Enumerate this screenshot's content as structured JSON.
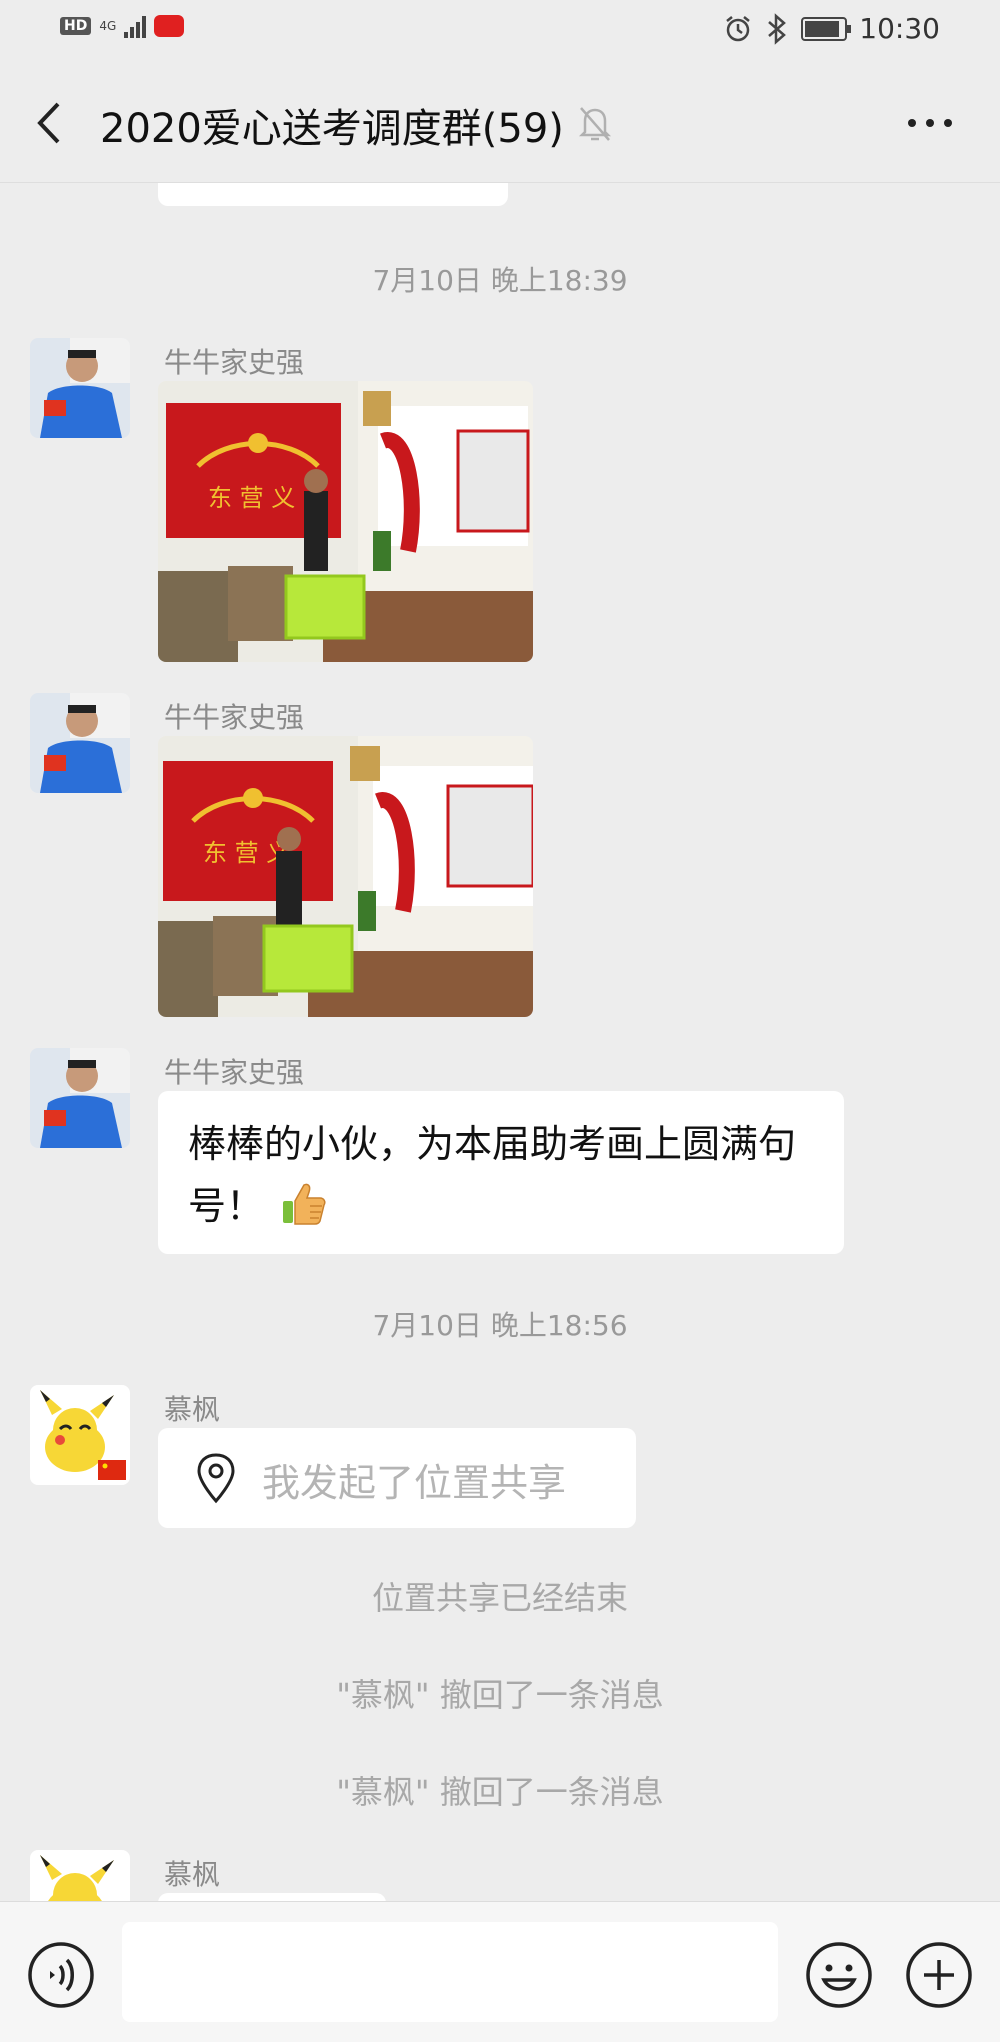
{
  "status_bar": {
    "hd_label": "HD",
    "network_label": "4G",
    "time": "10:30",
    "icons": [
      "signal-icon",
      "alarm-icon",
      "bluetooth-icon",
      "battery-icon"
    ],
    "battery_level": 0.9
  },
  "header": {
    "title": "2020爱心送考调度群(59)",
    "back_icon": "back-chevron-icon",
    "mute_icon": "muted-bell-icon",
    "more_icon": "more-dots-icon"
  },
  "messages": [
    {
      "kind": "timestamp",
      "text": "7月10日 晚上18:39"
    },
    {
      "kind": "image",
      "sender": "牛牛家史强",
      "image": "volunteer-with-green-box-photo"
    },
    {
      "kind": "image",
      "sender": "牛牛家史强",
      "image": "volunteer-with-green-box-photo"
    },
    {
      "kind": "text",
      "sender": "牛牛家史强",
      "text": "棒棒的小伙，为本届助考画上圆满句号！",
      "emoji": "thumbs-up-icon"
    },
    {
      "kind": "timestamp",
      "text": "7月10日 晚上18:56"
    },
    {
      "kind": "location",
      "sender": "慕枫",
      "text": "我发起了位置共享",
      "icon": "location-pin-icon"
    },
    {
      "kind": "system",
      "text": "位置共享已经结束"
    },
    {
      "kind": "system",
      "text": "\"慕枫\" 撤回了一条消息"
    },
    {
      "kind": "system",
      "text": "\"慕枫\" 撤回了一条消息"
    },
    {
      "kind": "partial",
      "sender": "慕枫"
    }
  ],
  "input_bar": {
    "voice_icon": "voice-icon",
    "input_value": "",
    "emoji_icon": "emoji-icon",
    "plus_icon": "plus-icon"
  },
  "colors": {
    "background": "#ededed",
    "bubble": "#ffffff",
    "input_bar": "#f6f6f6"
  }
}
